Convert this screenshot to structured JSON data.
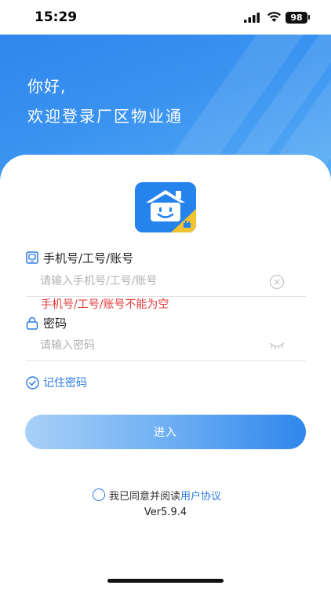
{
  "status_bar": {
    "time": "15:29",
    "battery": "98"
  },
  "header": {
    "greeting": "你好,",
    "welcome": "欢迎登录厂区物业通"
  },
  "form": {
    "account": {
      "label": "手机号/工号/账号",
      "placeholder": "请输入手机号/工号/账号",
      "value": "",
      "error": "手机号/工号/账号不能为空"
    },
    "password": {
      "label": "密码",
      "placeholder": "请输入密码",
      "value": ""
    },
    "remember_label": "记住密码",
    "remember_checked": true,
    "login_label": "进入"
  },
  "agreement": {
    "text": "我已同意并阅读",
    "link": "用户协议",
    "checked": false
  },
  "version": "Ver5.9.4",
  "colors": {
    "primary": "#2f86ec",
    "link": "#2a7be6",
    "error": "#e43c3c",
    "logo_accent": "#f2c230"
  },
  "icons": {
    "account": "phone-card-icon",
    "password": "lock-icon",
    "clear": "clear-circle-icon",
    "visibility": "eye-closed-icon",
    "remember": "check-circle-icon"
  }
}
